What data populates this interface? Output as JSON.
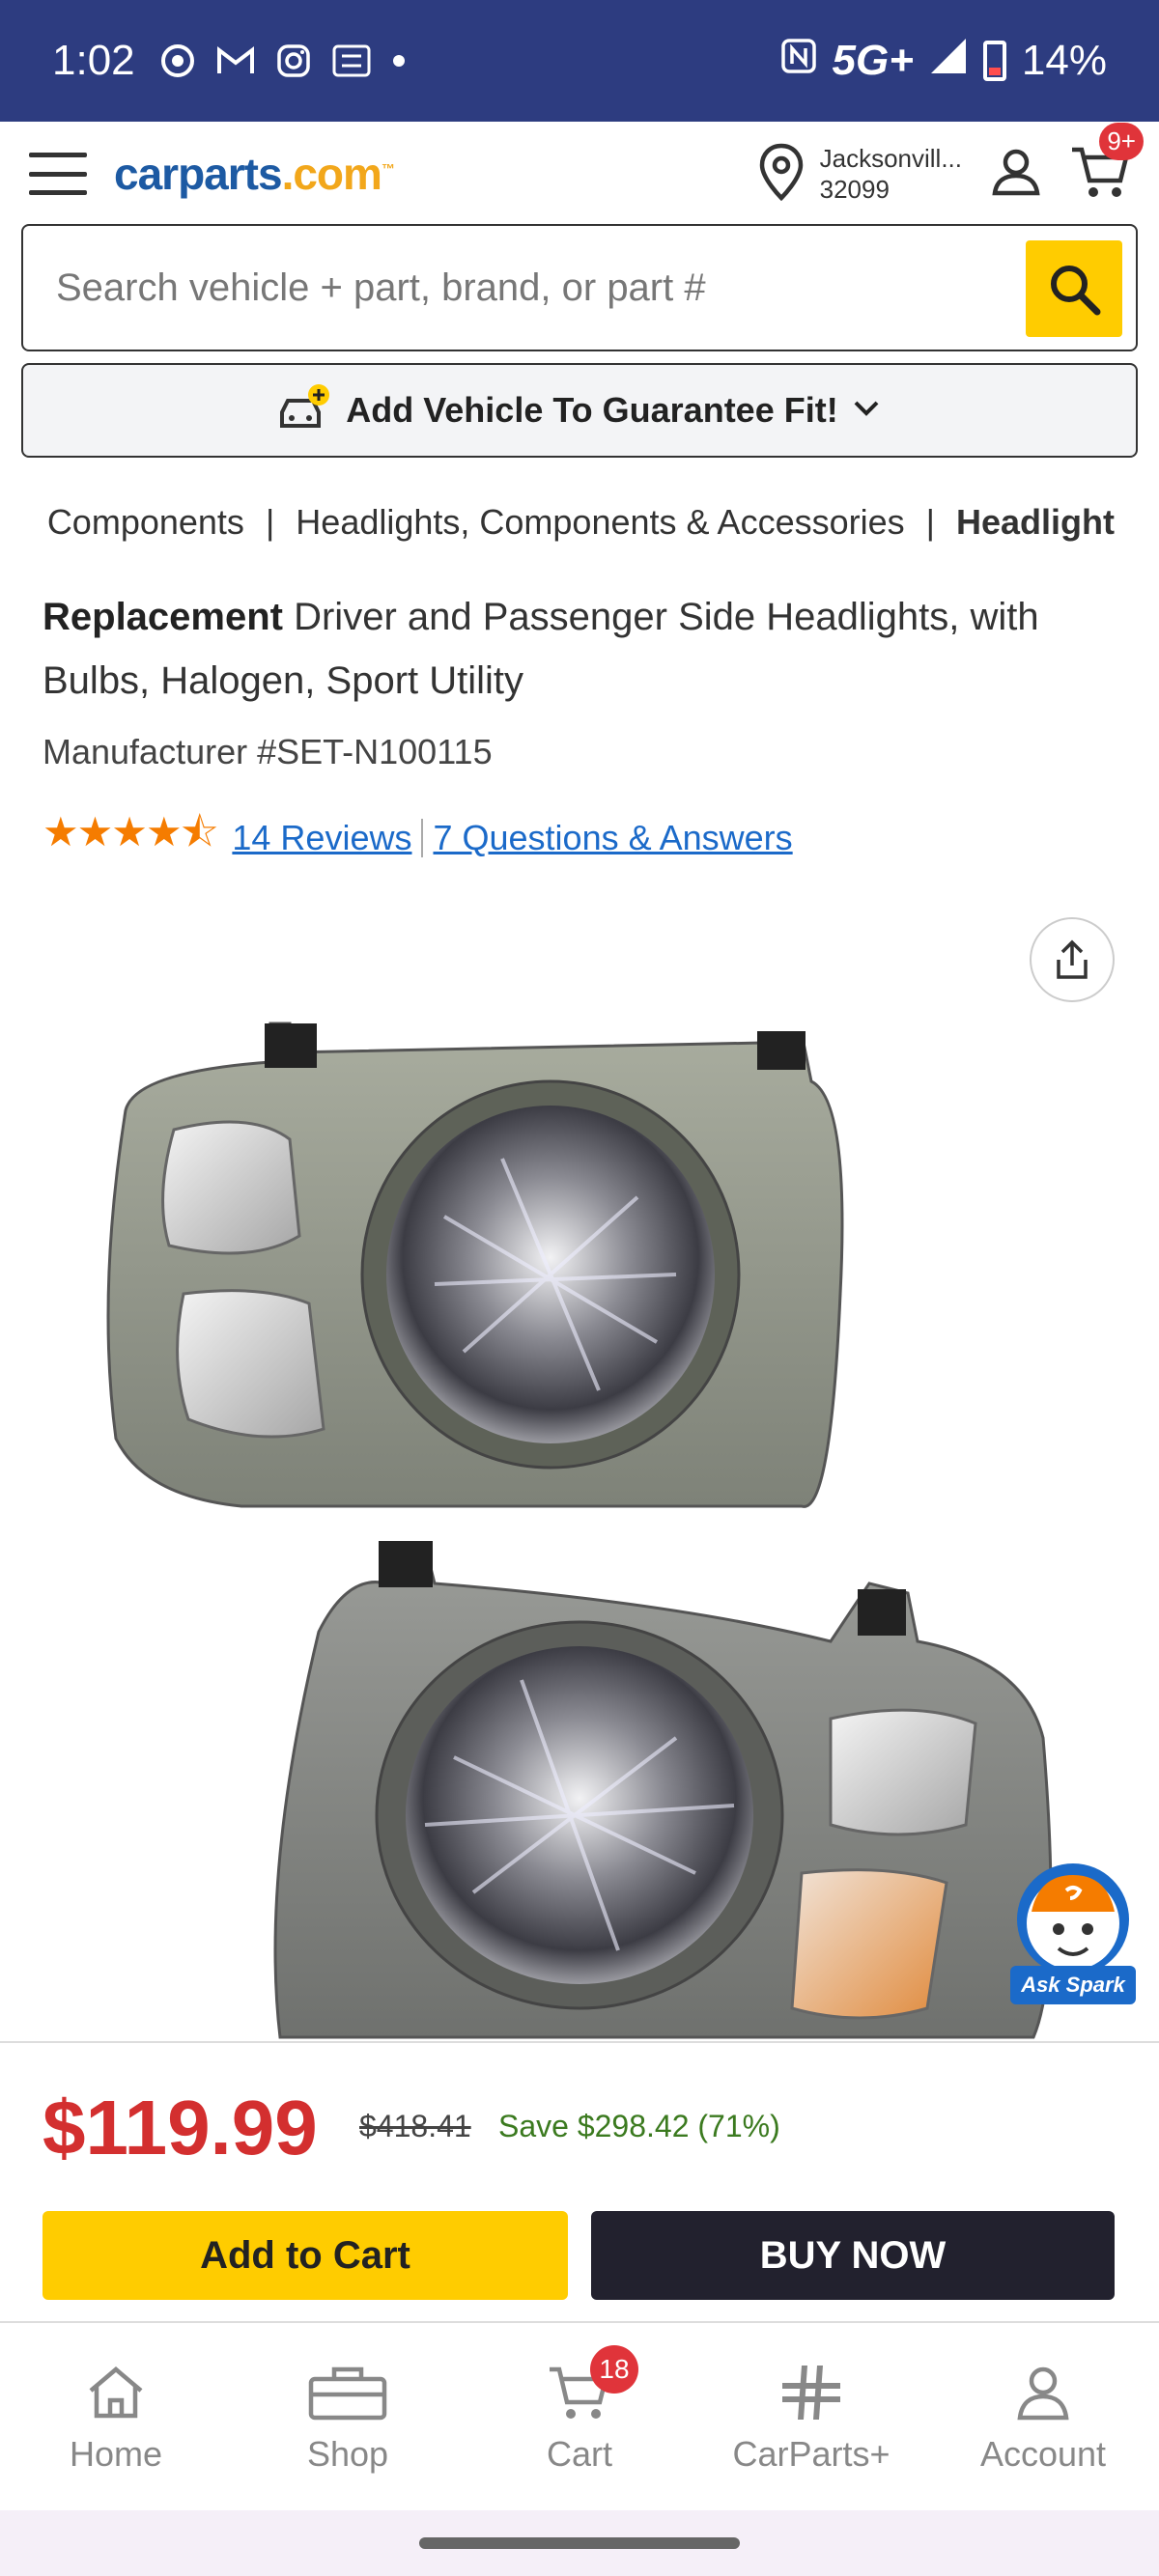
{
  "status_bar": {
    "time": "1:02",
    "network": "5G+",
    "battery": "14%"
  },
  "header": {
    "logo_main": "carparts",
    "logo_suffix": ".com",
    "logo_tm": "™",
    "location_city": "Jacksonvill...",
    "location_zip": "32099",
    "cart_badge": "9+"
  },
  "search": {
    "placeholder": "Search vehicle + part, brand, or part #"
  },
  "vehicle": {
    "label": "Add Vehicle To Guarantee Fit!"
  },
  "breadcrumb": {
    "items": [
      "Components",
      "Headlights, Components & Accessories"
    ],
    "current": "Headlight"
  },
  "product": {
    "title_brand": "Replacement",
    "title_rest": " Driver and Passenger Side Headlights, with Bulbs, Halogen, Sport Utility",
    "manufacturer": "Manufacturer #SET-N100115",
    "stars": "★★★★⯪",
    "reviews": "14 Reviews",
    "qa": "7 Questions & Answers"
  },
  "assistant": {
    "label": "Ask Spark"
  },
  "pricing": {
    "price": "$119.99",
    "old_price": "$418.41",
    "save": "Save $298.42 (71%)",
    "add_to_cart": "Add to Cart",
    "buy_now": "BUY NOW"
  },
  "nav": {
    "home": "Home",
    "shop": "Shop",
    "cart": "Cart",
    "cart_count": "18",
    "carparts_plus": "CarParts+",
    "account": "Account"
  },
  "colors": {
    "status_bar": "#2d3c80",
    "brand_blue": "#1d5aa3",
    "accent_yellow": "#ffcc00",
    "price_red": "#d32f2f",
    "save_green": "#3b7a1f"
  }
}
